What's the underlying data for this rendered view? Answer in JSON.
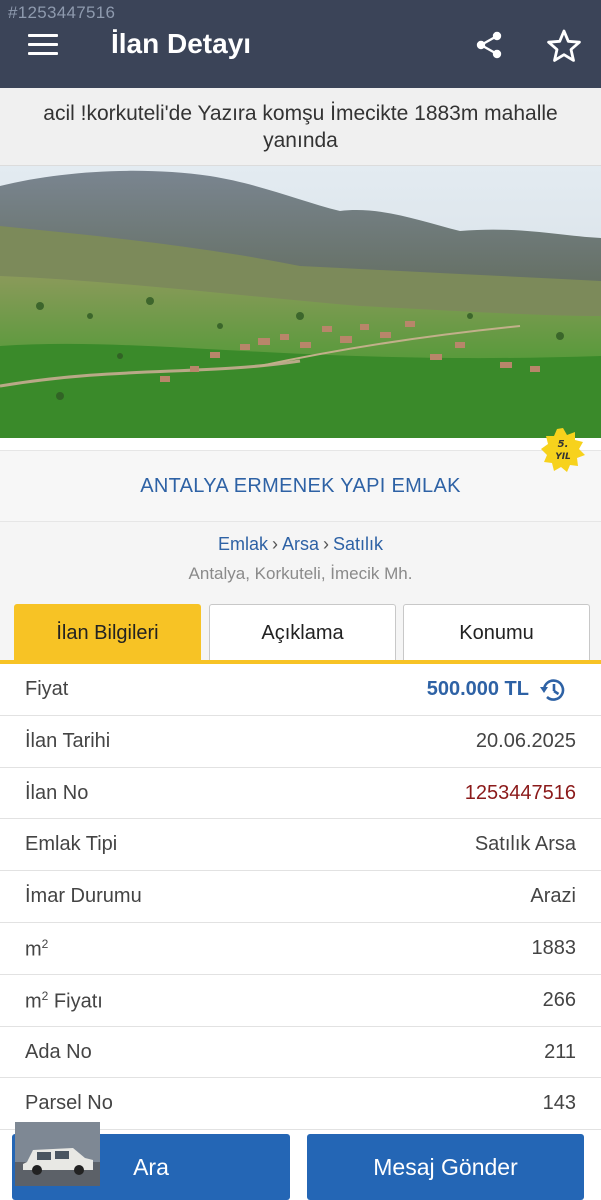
{
  "watermark_id": "#1253447516",
  "appbar": {
    "title": "İlan Detayı"
  },
  "listing_title": "acil !korkuteli'de Yazıra komşu İmecikte 1883m mahalle yanında",
  "badge": {
    "line1": "5.",
    "line2": "YIL"
  },
  "agency": "ANTALYA ERMENEK YAPI EMLAK",
  "breadcrumb": [
    "Emlak",
    "Arsa",
    "Satılık"
  ],
  "location": "Antalya, Korkuteli, İmecik Mh.",
  "tabs": [
    {
      "label": "İlan Bilgileri",
      "active": true
    },
    {
      "label": "Açıklama",
      "active": false
    },
    {
      "label": "Konumu",
      "active": false
    }
  ],
  "details": {
    "price_label": "Fiyat",
    "price_value": "500.000 TL",
    "date_label": "İlan Tarihi",
    "date_value": "20.06.2025",
    "no_label": "İlan No",
    "no_value": "1253447516",
    "type_label": "Emlak Tipi",
    "type_value": "Satılık Arsa",
    "zoning_label": "İmar Durumu",
    "zoning_value": "Arazi",
    "m2_label": "m",
    "m2_value": "1883",
    "m2price_label": "m",
    "m2price_suffix": " Fiyatı",
    "m2price_value": "266",
    "ada_label": "Ada No",
    "ada_value": "211",
    "parsel_label": "Parsel No",
    "parsel_value": "143"
  },
  "actions": {
    "call_label": "Ara",
    "message_label": "Mesaj Gönder"
  },
  "colors": {
    "appbar": "#3b4458",
    "accent_yellow": "#f7c325",
    "link_blue": "#2e62a5",
    "button_blue": "#2466b5",
    "listing_no_red": "#8b1a1a"
  },
  "icons": [
    "menu-icon",
    "share-icon",
    "star-icon",
    "price-history-icon"
  ]
}
